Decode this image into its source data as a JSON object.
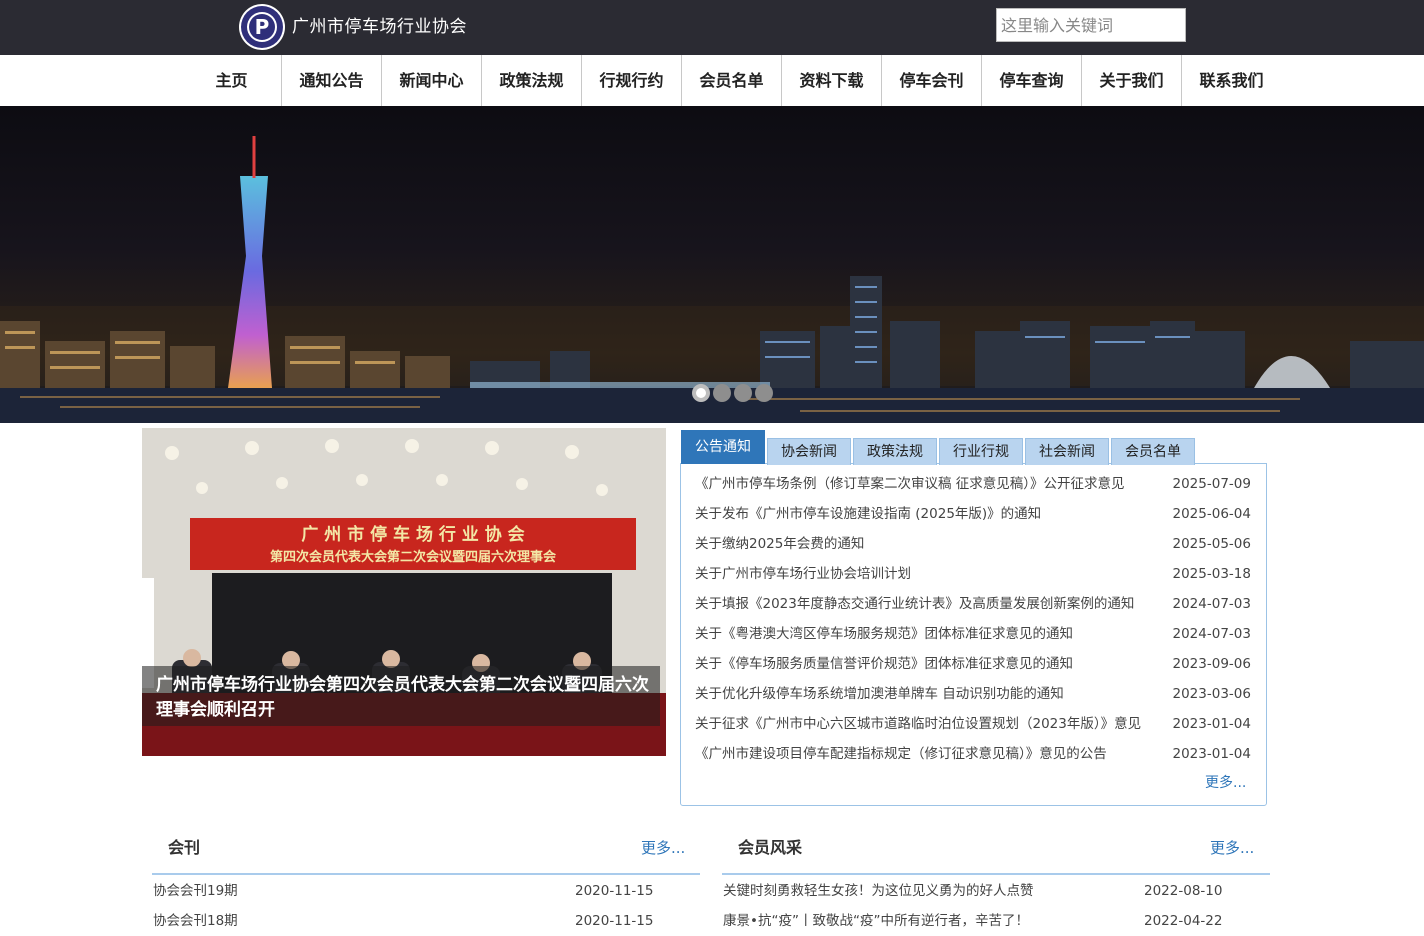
{
  "header": {
    "site_title": "广州市停车场行业协会",
    "search_placeholder": "这里输入关键词"
  },
  "nav": {
    "items": [
      "主页",
      "通知公告",
      "新闻中心",
      "政策法规",
      "行规行约",
      "会员名单",
      "资料下载",
      "停车会刊",
      "停车查询",
      "关于我们",
      "联系我们"
    ]
  },
  "banner": {
    "slide_count": 4,
    "active_slide": 1
  },
  "feature": {
    "banner_line1": "广 州 市 停 车 场 行 业 协 会",
    "banner_line2": "第四次会员代表大会第二次会议暨四届六次理事会",
    "caption": "广州市停车场行业协会第四次会员代表大会第二次会议暨四届六次理事会顺利召开"
  },
  "tabs": {
    "items": [
      "公告通知",
      "协会新闻",
      "政策法规",
      "行业行规",
      "社会新闻",
      "会员名单"
    ],
    "active": 0
  },
  "notices": [
    {
      "title": "《广州市停车场条例（修订草案二次审议稿 征求意见稿）》公开征求意见",
      "date": "2025-07-09"
    },
    {
      "title": "关于发布《广州市停车设施建设指南 (2025年版)》的通知",
      "date": "2025-06-04"
    },
    {
      "title": "关于缴纳2025年会费的通知",
      "date": "2025-05-06"
    },
    {
      "title": "关于广州市停车场行业协会培训计划",
      "date": "2025-03-18"
    },
    {
      "title": "关于填报《2023年度静态交通行业统计表》及高质量发展创新案例的通知",
      "date": "2024-07-03"
    },
    {
      "title": "关于《粤港澳大湾区停车场服务规范》团体标准征求意见的通知",
      "date": "2024-07-03"
    },
    {
      "title": "关于《停车场服务质量信誉评价规范》团体标准征求意见的通知",
      "date": "2023-09-06"
    },
    {
      "title": "关于优化升级停车场系统增加澳港单牌车 自动识别功能的通知",
      "date": "2023-03-06"
    },
    {
      "title": "关于征求《广州市中心六区城市道路临时泊位设置规划（2023年版）》意见",
      "date": "2023-01-04"
    },
    {
      "title": "《广州市建设项目停车配建指标规定（修订征求意见稿）》意见的公告",
      "date": "2023-01-04"
    }
  ],
  "panel_more": "更多...",
  "journal": {
    "title": "会刊",
    "more": "更多...",
    "items": [
      {
        "title": "协会会刊19期",
        "date": "2020-11-15"
      },
      {
        "title": "协会会刊18期",
        "date": "2020-11-15"
      }
    ]
  },
  "members": {
    "title": "会员风采",
    "more": "更多...",
    "items": [
      {
        "title": "关键时刻勇救轻生女孩！为这位见义勇为的好人点赞",
        "date": "2022-08-10"
      },
      {
        "title": "康景•抗“疫”丨致敬战“疫”中所有逆行者，辛苦了！",
        "date": "2022-04-22"
      }
    ]
  },
  "colors": {
    "header_bg": "#2b2b33",
    "accent": "#2f76b9",
    "tab_bg": "#b9d4ef"
  }
}
